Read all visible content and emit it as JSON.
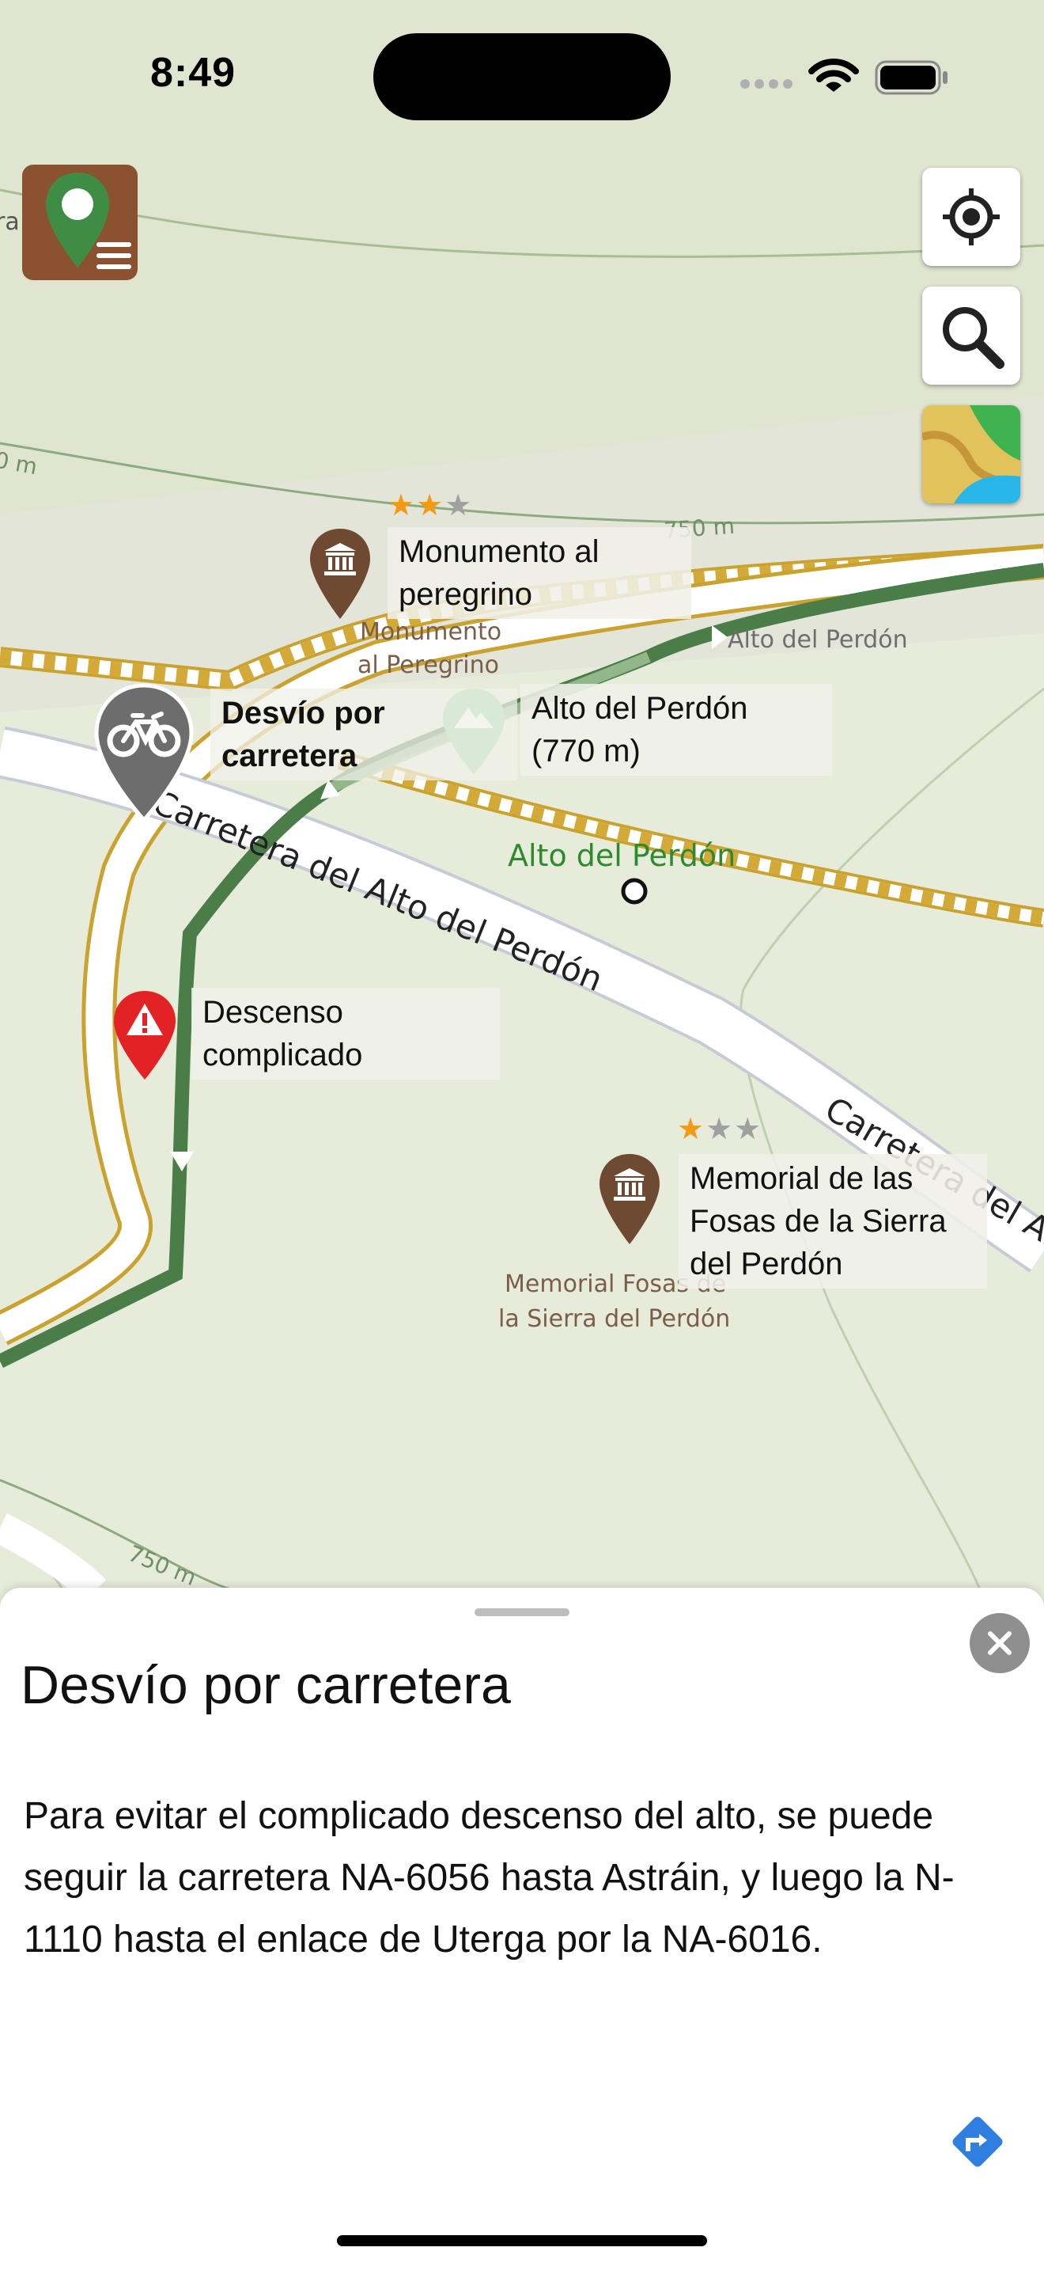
{
  "status_bar": {
    "time": "8:49"
  },
  "map": {
    "contour_labels": [
      "0 m",
      "750 m",
      "750 m"
    ],
    "road_labels": [
      "Carretera del Alto del Perdón",
      "Carretera del Al"
    ],
    "poi_map_labels": {
      "monumento": [
        "Monumento",
        "al Peregrino"
      ],
      "memorial": [
        "Memorial Fosas de",
        "la Sierra del Perdón"
      ],
      "alto_arrow": "Alto del Perdón",
      "alto_green": "Alto del Perdón",
      "left_edge": "ra"
    },
    "pois": [
      {
        "name": "monumento",
        "label_lines": [
          "Monumento al",
          "peregrino"
        ],
        "rating": 2,
        "max_rating": 3
      },
      {
        "name": "desvio",
        "label_lines": [
          "Desvío por",
          "carretera"
        ]
      },
      {
        "name": "alto",
        "label_lines": [
          "Alto del Perdón",
          "(770 m)"
        ]
      },
      {
        "name": "descenso",
        "label_lines": [
          "Descenso",
          "complicado"
        ]
      },
      {
        "name": "memorial",
        "label_lines": [
          "Memorial de las",
          "Fosas de la Sierra",
          "del Perdón"
        ],
        "rating": 1,
        "max_rating": 3
      }
    ],
    "colors": {
      "route": "#4a7d48",
      "road_casing": "#d8b23a",
      "poi_brown": "#6f4a32",
      "poi_gray": "#6d6d6d",
      "poi_red": "#e32226",
      "poi_green": "#8fd89a",
      "star_on": "#f29a12",
      "star_off": "#a0a0a0"
    }
  },
  "controls": {
    "menu_button": "map-marker-menu-icon",
    "locate_button": "locate-icon",
    "search_button": "search-icon",
    "layers_button": "map-layers-icon"
  },
  "sheet": {
    "title": "Desvío por carretera",
    "body": "Para evitar el complicado descenso del alto, se puede seguir la carretera NA-6056 hasta Astráin, y luego la N-1110 hasta el enlace de Uterga por la NA-6016.",
    "close_icon": "close-icon",
    "directions_icon": "directions-icon"
  }
}
